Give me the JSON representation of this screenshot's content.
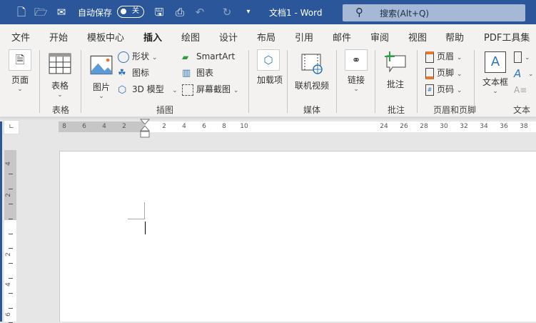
{
  "titlebar": {
    "autosave_label": "自动保存",
    "autosave_state": "关",
    "doc_title": "文档1  -  Word",
    "search_placeholder": "搜索(Alt+Q)"
  },
  "tabs": [
    "文件",
    "开始",
    "模板中心",
    "插入",
    "绘图",
    "设计",
    "布局",
    "引用",
    "邮件",
    "审阅",
    "视图",
    "帮助",
    "PDF工具集"
  ],
  "active_tab": "插入",
  "ribbon": {
    "pages": "页面",
    "table": "表格",
    "picture": "图片",
    "shapes": "形状",
    "icons": "图标",
    "model3d": "3D 模型",
    "smartart": "SmartArt",
    "chart": "图表",
    "screenshot": "屏幕截图",
    "addins": "加载项",
    "addins2": "项",
    "online_video": "联机视频",
    "link": "链接",
    "comment": "批注",
    "header": "页眉",
    "footer": "页脚",
    "page_number": "页码",
    "textbox": "文本框",
    "groups": {
      "table": "表格",
      "illustrations": "插图",
      "media": "媒体",
      "comments": "批注",
      "header_footer": "页眉和页脚",
      "text": "文本"
    }
  },
  "ruler": {
    "left": [
      "8",
      "6",
      "4",
      "2"
    ],
    "right": [
      "2",
      "4",
      "6",
      "8",
      "10"
    ],
    "far": [
      "24",
      "26",
      "28",
      "30",
      "32",
      "34",
      "36",
      "38"
    ],
    "vertical": [
      "4",
      "2",
      "2",
      "4",
      "6"
    ]
  },
  "colors": {
    "titlebar": "#2b579a",
    "accent": "#2b579a"
  }
}
